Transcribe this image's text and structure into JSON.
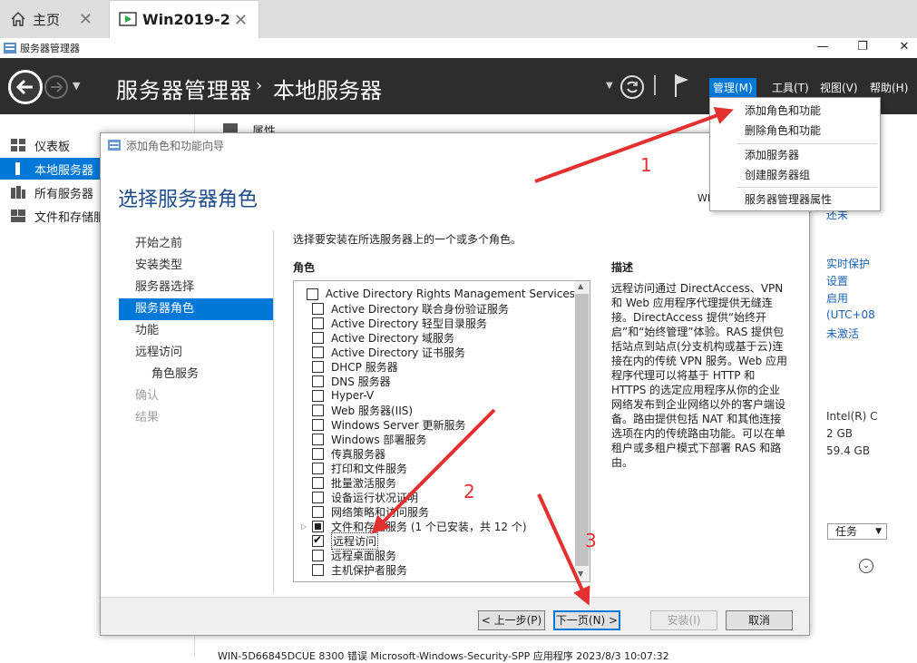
{
  "browser": {
    "tabs": [
      {
        "label": "主页",
        "icon": "home-icon"
      },
      {
        "label": "Win2019-2",
        "icon": "vm-icon"
      }
    ]
  },
  "window": {
    "title": "服务器管理器",
    "controls": [
      "—",
      "❐",
      "✕"
    ]
  },
  "header": {
    "title": "服务器管理器",
    "separator": "›",
    "subtitle": "本地服务器",
    "menus": [
      "管理(M)",
      "工具(T)",
      "视图(V)",
      "帮助(H)"
    ]
  },
  "sidebar": {
    "items": [
      {
        "label": "仪表板",
        "icon": "dashboard-icon"
      },
      {
        "label": "本地服务器",
        "icon": "local-server-icon"
      },
      {
        "label": "所有服务器",
        "icon": "all-servers-icon"
      },
      {
        "label": "文件和存储服务",
        "icon": "file-storage-icon"
      }
    ]
  },
  "background": {
    "properties_label": "属性",
    "right_links": [
      "还未",
      "实时保护",
      "设置",
      "启用",
      "(UTC+08",
      "未激活"
    ],
    "right_info": [
      "Intel(R) C",
      "2 GB",
      "59.4 GB"
    ],
    "tasks_label": "任务",
    "bottom_row": "WIN-5D66845DCUE   8300   错误      Microsoft-Windows-Security-SPP   应用程序   2023/8/3 10:07:32"
  },
  "wizard": {
    "title": "添加角色和功能向导",
    "heading": "选择服务器角色",
    "server_label": "WIN",
    "steps": [
      {
        "label": "开始之前",
        "state": "normal"
      },
      {
        "label": "安装类型",
        "state": "normal"
      },
      {
        "label": "服务器选择",
        "state": "normal"
      },
      {
        "label": "服务器角色",
        "state": "selected"
      },
      {
        "label": "功能",
        "state": "normal"
      },
      {
        "label": "远程访问",
        "state": "normal"
      },
      {
        "label": "角色服务",
        "state": "sub"
      },
      {
        "label": "确认",
        "state": "disabled"
      },
      {
        "label": "结果",
        "state": "disabled"
      }
    ],
    "instruction": "选择要安装在所选服务器上的一个或多个角色。",
    "roles_header": "角色",
    "desc_header": "描述",
    "roles": [
      {
        "label": "Active Directory Rights Management Services",
        "state": "unchecked"
      },
      {
        "label": "Active Directory 联合身份验证服务",
        "state": "unchecked"
      },
      {
        "label": "Active Directory 轻型目录服务",
        "state": "unchecked"
      },
      {
        "label": "Active Directory 域服务",
        "state": "unchecked"
      },
      {
        "label": "Active Directory 证书服务",
        "state": "unchecked"
      },
      {
        "label": "DHCP 服务器",
        "state": "unchecked"
      },
      {
        "label": "DNS 服务器",
        "state": "unchecked"
      },
      {
        "label": "Hyper-V",
        "state": "unchecked"
      },
      {
        "label": "Web 服务器(IIS)",
        "state": "unchecked"
      },
      {
        "label": "Windows Server 更新服务",
        "state": "unchecked"
      },
      {
        "label": "Windows 部署服务",
        "state": "unchecked"
      },
      {
        "label": "传真服务器",
        "state": "unchecked"
      },
      {
        "label": "打印和文件服务",
        "state": "unchecked"
      },
      {
        "label": "批量激活服务",
        "state": "unchecked"
      },
      {
        "label": "设备运行状况证明",
        "state": "unchecked"
      },
      {
        "label": "网络策略和访问服务",
        "state": "unchecked"
      },
      {
        "label": "文件和存储服务 (1 个已安装，共 12 个)",
        "state": "partial",
        "expandable": true
      },
      {
        "label": "远程访问",
        "state": "checked",
        "focused": true
      },
      {
        "label": "远程桌面服务",
        "state": "unchecked"
      },
      {
        "label": "主机保护者服务",
        "state": "unchecked"
      }
    ],
    "description": "远程访问通过 DirectAccess、VPN 和 Web 应用程序代理提供无缝连接。DirectAccess 提供“始终开启”和“始终管理”体验。RAS 提供包括站点到站点(分支机构或基于云)连接在内的传统 VPN 服务。Web 应用程序代理可以将基于 HTTP 和 HTTPS 的选定应用程序从你的企业网络发布到企业网络以外的客户端设备。路由提供包括 NAT 和其他连接选项在内的传统路由功能。可以在单租户或多租户模式下部署 RAS 和路由。",
    "buttons": {
      "prev": "< 上一步(P)",
      "next": "下一页(N) >",
      "install": "安装(I)",
      "cancel": "取消"
    }
  },
  "manage_menu": {
    "items": [
      "添加角色和功能",
      "删除角色和功能",
      "添加服务器",
      "创建服务器组",
      "服务器管理器属性"
    ]
  },
  "annotations": {
    "labels": [
      "1",
      "2",
      "3"
    ],
    "color": "#e53030"
  }
}
